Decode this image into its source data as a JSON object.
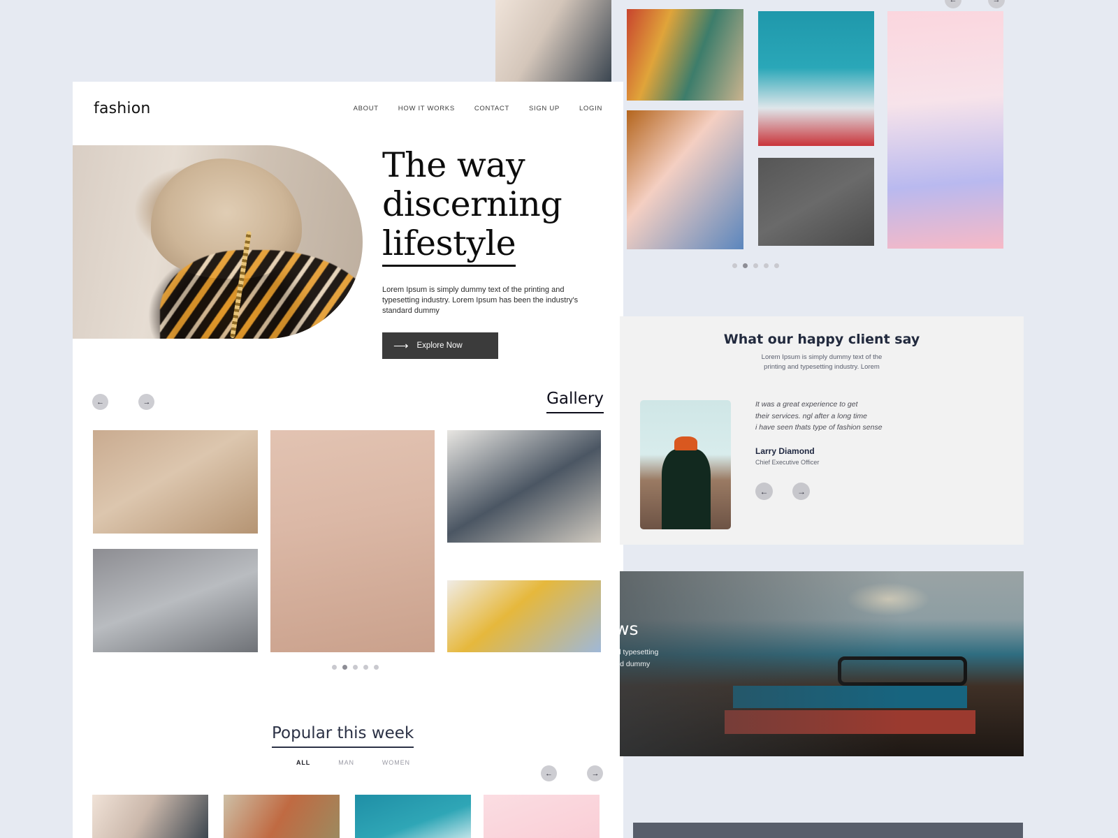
{
  "brand": {
    "logo": "fashion",
    "accent": "#3b3b3b",
    "page_bg": "#e6eaf2",
    "footer_bg": "#585e6b"
  },
  "nav": {
    "items": [
      {
        "label": "ABOUT"
      },
      {
        "label": "HOW IT WORKS"
      },
      {
        "label": "CONTACT"
      },
      {
        "label": "SIGN UP"
      },
      {
        "label": "LOGIN"
      }
    ]
  },
  "hero": {
    "title_line1": "The way",
    "title_line2": "discerning",
    "title_line3": "lifestyle",
    "paragraph": "Lorem Ipsum is simply dummy text of the printing and typesetting industry. Lorem Ipsum has been the industry's standard dummy",
    "cta_label": "Explore Now",
    "cta_icon": "arrow-right-icon",
    "image_alt": "french-bulldog-in-patterned-shirt"
  },
  "gallery": {
    "title": "Gallery",
    "prev_icon": "arrow-left-icon",
    "next_icon": "arrow-right-icon",
    "items": [
      {
        "alt": "hallway-bench-with-bags-and-umbrellas"
      },
      {
        "alt": "grey-knit-sneakers-on-feet"
      },
      {
        "alt": "clothes-on-wooden-hangers-pink-wall"
      },
      {
        "alt": "packed-suitcase-flat-lay-with-straw-hat"
      },
      {
        "alt": "yellow-sneakers-jeans-and-hat-flat-lay"
      }
    ],
    "dots": {
      "count": 5,
      "active": 1
    }
  },
  "popular": {
    "title": "Popular this week",
    "tabs": [
      {
        "label": "ALL",
        "active": true
      },
      {
        "label": "MAN",
        "active": false
      },
      {
        "label": "WOMEN",
        "active": false
      }
    ],
    "prev_icon": "arrow-left-icon",
    "next_icon": "arrow-right-icon",
    "cards": [
      {
        "alt": "dark-sneaker-with-monstera-leaves"
      },
      {
        "alt": "colourful-clothing-rack"
      },
      {
        "alt": "teal-sky-with-clouds"
      },
      {
        "alt": "plain-pink-backdrop"
      }
    ]
  },
  "showcase": {
    "prev_icon": "arrow-left-icon",
    "next_icon": "arrow-right-icon",
    "tiles": [
      {
        "alt": "sneaker-sunglasses-flat-lay-with-leaves"
      },
      {
        "alt": "colourful-clothing-rack"
      },
      {
        "alt": "tan-jacket-pink-blouse-and-jeans-on-hangers"
      },
      {
        "alt": "man-in-red-hoodie-against-sky"
      },
      {
        "alt": "two-dress-shirts-with-ties-on-grey"
      },
      {
        "alt": "pastel-sneaker-on-pink-and-lilac"
      }
    ],
    "dots": {
      "count": 5,
      "active": 1
    }
  },
  "testimonial": {
    "title": "What our happy client say",
    "subtitle_line1": "Lorem Ipsum is simply dummy text of the",
    "subtitle_line2": "printing and typesetting industry. Lorem",
    "quote_line1": "It was a great experience to get",
    "quote_line2": "their services. ngl after a long time",
    "quote_line3": "i have seen thats type of fashion sense",
    "author_name": "Larry Diamond",
    "author_role": "Chief Executive Officer",
    "photo_alt": "man-in-orange-beanie-and-black-turtleneck",
    "prev_icon": "arrow-left-icon",
    "next_icon": "arrow-right-icon"
  },
  "news": {
    "title": "d news",
    "text_line1": "e printing and typesetting",
    "text_line2": "stry's standard dummy",
    "image_alt": "sunglasses-resting-on-stack-of-books-by-the-sea"
  }
}
